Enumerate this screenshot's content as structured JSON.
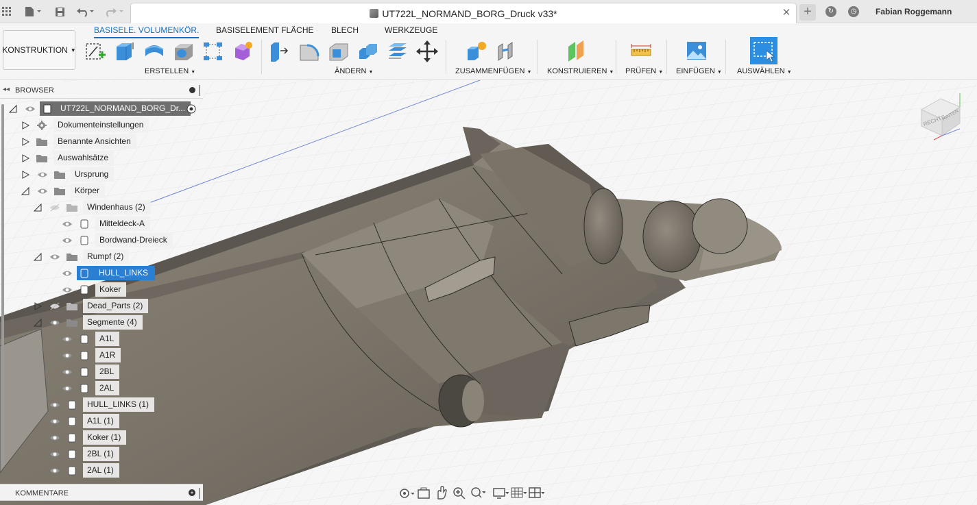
{
  "window": {
    "document_title": "UT722L_NORMAND_BORG_Druck v33*",
    "user_name": "Fabian Roggemann"
  },
  "ribbon": {
    "workspace": "KONSTRUKTION",
    "tabs": [
      {
        "label": "BASISELE. VOLUMENKÖR.",
        "active": true
      },
      {
        "label": "BASISELEMENT FLÄCHE",
        "active": false
      },
      {
        "label": "BLECH",
        "active": false
      },
      {
        "label": "WERKZEUGE",
        "active": false
      }
    ],
    "groups": {
      "erstellen": "ERSTELLEN",
      "aendern": "ÄNDERN",
      "zusammenfuegen": "ZUSAMMENFÜGEN",
      "konstruieren": "KONSTRUIEREN",
      "pruefen": "PRÜFEN",
      "einfuegen": "EINFÜGEN",
      "auswaehlen": "AUSWÄHLEN"
    },
    "accent_color": "#1a6fb8"
  },
  "browser": {
    "title": "BROWSER",
    "root": "UT722L_NORMAND_BORG_Dr...",
    "items": [
      {
        "label": "Dokumenteinstellungen"
      },
      {
        "label": "Benannte Ansichten"
      },
      {
        "label": "Auswahlsätze"
      },
      {
        "label": "Ursprung"
      },
      {
        "label": "Körper"
      },
      {
        "label": "Windenhaus (2)"
      },
      {
        "label": "Mitteldeck-A"
      },
      {
        "label": "Bordwand-Dreieck"
      },
      {
        "label": "Rumpf (2)"
      },
      {
        "label": "HULL_LINKS",
        "selected": true
      },
      {
        "label": "Koker"
      },
      {
        "label": "Dead_Parts (2)"
      },
      {
        "label": "Segmente (4)"
      },
      {
        "label": "A1L"
      },
      {
        "label": "A1R"
      },
      {
        "label": "2BL"
      },
      {
        "label": "2AL"
      },
      {
        "label": "HULL_LINKS (1)"
      },
      {
        "label": "A1L (1)"
      },
      {
        "label": "Koker (1)"
      },
      {
        "label": "2BL (1)"
      },
      {
        "label": "2AL (1)"
      }
    ],
    "selection_color": "#2b7fd3"
  },
  "comments": {
    "title": "KOMMENTARE"
  },
  "viewcube": {
    "face_label": "RECHTS",
    "face_label_2": "HINTEN"
  }
}
